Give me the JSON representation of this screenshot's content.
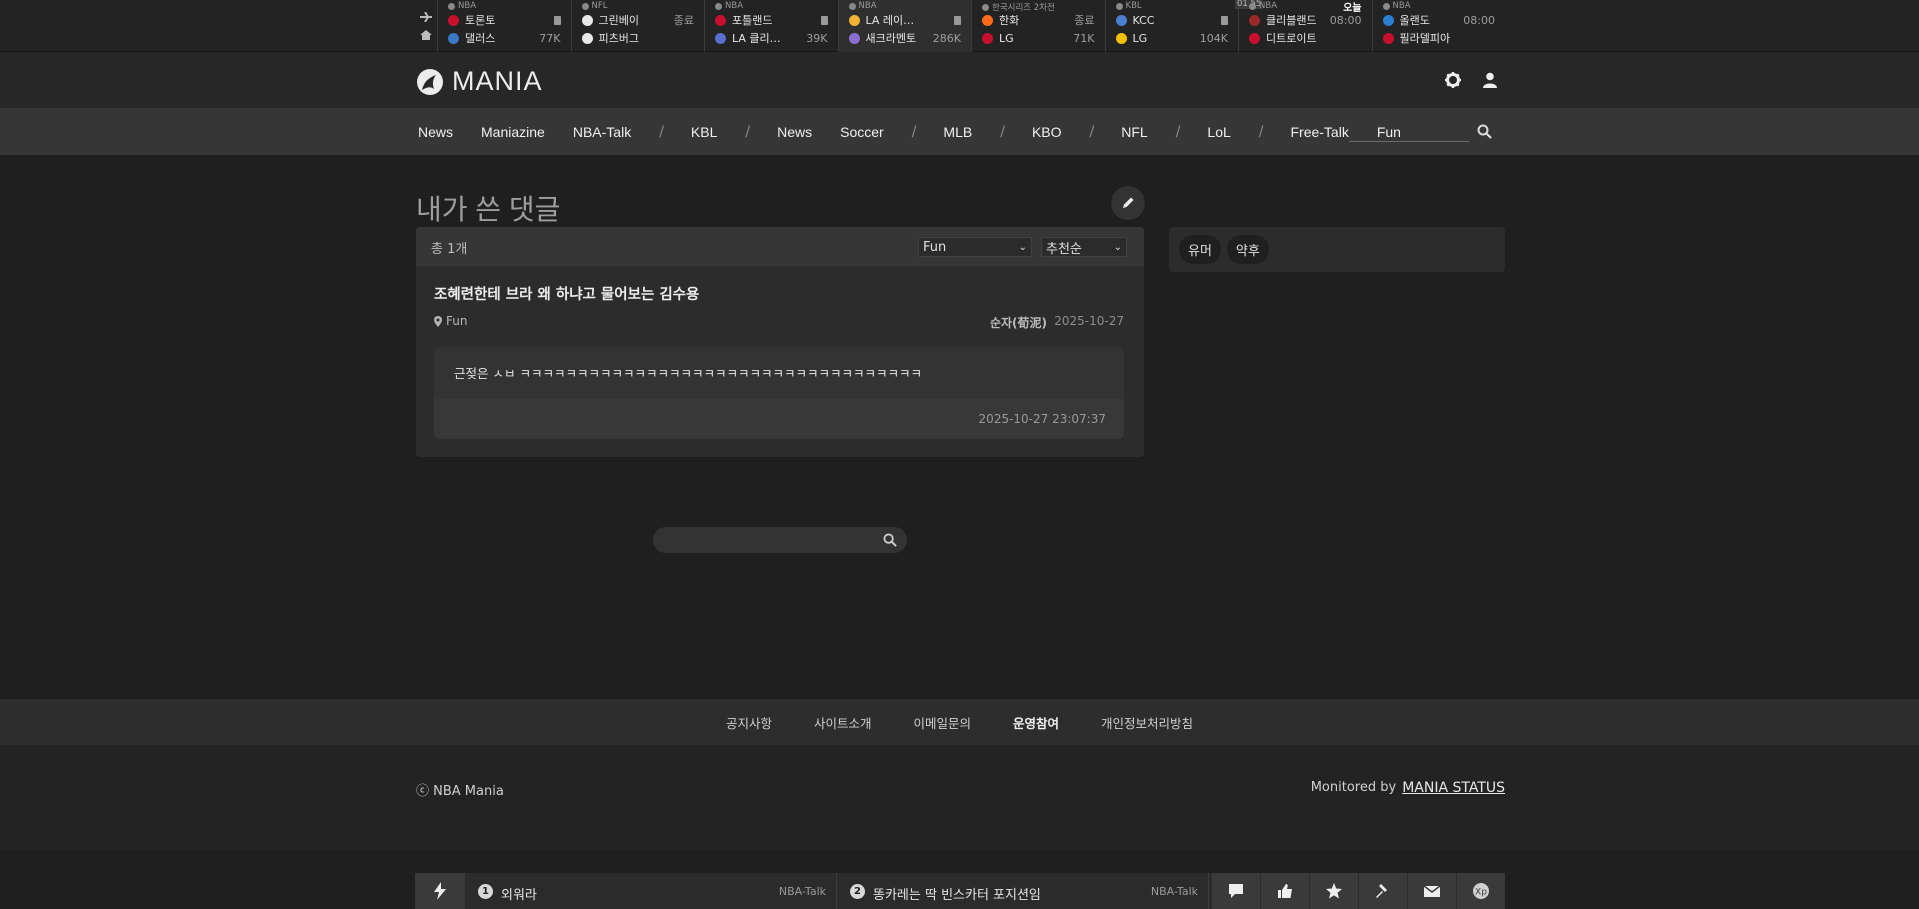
{
  "scoreboard": {
    "games": [
      {
        "league": "NBA",
        "home": "토론토",
        "away": "댈러스",
        "home_stat": "",
        "away_stat": "77K",
        "home_color": "#c8102e",
        "away_color": "#3a78c8"
      },
      {
        "league": "NFL",
        "home": "그린베이",
        "away": "피츠버그",
        "home_stat": "종료",
        "away_stat": "",
        "home_color": "#e8e8e8",
        "away_color": "#e8e8e8"
      },
      {
        "league": "NBA",
        "home": "포틀랜드",
        "away": "LA 클리…",
        "home_stat": "",
        "away_stat": "39K",
        "home_color": "#c8102e",
        "away_color": "#5a6fd0"
      },
      {
        "league": "NBA",
        "home": "LA 레이…",
        "away": "새크라멘토",
        "home_stat": "",
        "away_stat": "286K",
        "home_color": "#f2b233",
        "away_color": "#8a6fd0"
      },
      {
        "league": "한국시리즈 2차전",
        "home": "한화",
        "away": "LG",
        "home_stat": "종료",
        "away_stat": "71K",
        "home_color": "#ff6a1a",
        "away_color": "#c8102e"
      },
      {
        "league": "KBL",
        "home": "KCC",
        "away": "LG",
        "home_stat": "",
        "away_stat": "104K",
        "home_color": "#4a7fd0",
        "away_color": "#f2c200"
      },
      {
        "league": "NBA",
        "home": "클리블랜드",
        "away": "디트로이트",
        "home_stat": "08:00",
        "away_stat": "",
        "home_color": "#9a2a2a",
        "away_color": "#c8102e",
        "today": "오늘",
        "clock": "01 55"
      },
      {
        "league": "NBA",
        "home": "올랜도",
        "away": "필라델피아",
        "home_stat": "08:00",
        "away_stat": "",
        "home_color": "#2a7fd0",
        "away_color": "#c8102e"
      }
    ]
  },
  "header": {
    "logo": "MANIA",
    "settings_icon": "gear-icon",
    "user_icon": "user-icon"
  },
  "nav": {
    "items": [
      "News",
      "Maniazine",
      "NBA-Talk",
      "/",
      "KBL",
      "/",
      "News",
      "Soccer",
      "/",
      "MLB",
      "/",
      "KBO",
      "/",
      "NFL",
      "/",
      "LoL",
      "/",
      "Free-Talk",
      "Fun"
    ]
  },
  "main": {
    "title": "내가 쓴 댓글",
    "count": "총 1개",
    "filter_board": "Fun",
    "filter_sort": "추천순",
    "post": {
      "title": "조혜련한테 브라 왜 하냐고 물어보는 김수용",
      "board": "Fun",
      "author": "순자(荀泥)",
      "date": "2025-10-27",
      "comment": "근젖은 ㅅㅂ ㅋㅋㅋㅋㅋㅋㅋㅋㅋㅋㅋㅋㅋㅋㅋㅋㅋㅋㅋㅋㅋㅋㅋㅋㅋㅋㅋㅋㅋㅋㅋㅋㅋㅋㅋ",
      "comment_time": "2025-10-27 23:07:37"
    }
  },
  "sidebar": {
    "tags": [
      "유머",
      "약후"
    ]
  },
  "footer": {
    "links": [
      "공지사항",
      "사이트소개",
      "이메일문의",
      "운영참여",
      "개인정보처리방침"
    ],
    "copyright": "ⓒ NBA Mania",
    "monitored_label": "Monitored by",
    "monitored_link": "MANIA STATUS"
  },
  "ticker": {
    "items": [
      {
        "num": "1",
        "title": "외워라",
        "board": "NBA-Talk"
      },
      {
        "num": "2",
        "title": "똥카레는 딱 빈스카터 포지션임",
        "board": "NBA-Talk"
      }
    ],
    "icons": [
      "chat-icon",
      "thumbs-up-icon",
      "star-icon",
      "hammer-icon",
      "mail-icon",
      "xp-icon"
    ]
  }
}
